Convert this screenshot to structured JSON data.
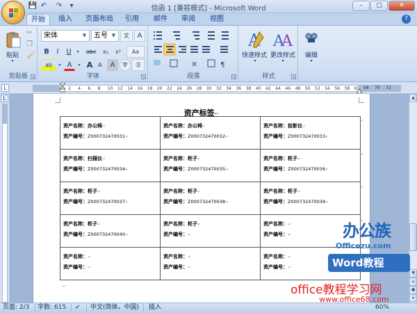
{
  "window": {
    "title": "信函 1 [兼容模式] - Microsoft Word",
    "buttons": {
      "minimize": "–",
      "maximize": "□",
      "close": "✕"
    }
  },
  "quick_access": {
    "save": "💾",
    "undo": "↶",
    "redo": "↷",
    "customize": "▾"
  },
  "tabs": [
    {
      "label": "开始",
      "active": true
    },
    {
      "label": "插入",
      "active": false
    },
    {
      "label": "页面布局",
      "active": false
    },
    {
      "label": "引用",
      "active": false
    },
    {
      "label": "邮件",
      "active": false
    },
    {
      "label": "审阅",
      "active": false
    },
    {
      "label": "视图",
      "active": false
    }
  ],
  "ribbon": {
    "clipboard": {
      "group_label": "剪贴板",
      "paste_label": "粘贴"
    },
    "font": {
      "group_label": "字体",
      "font_name": "宋体",
      "font_size": "五号",
      "bold": "B",
      "italic": "I",
      "underline": "U",
      "strike": "abc",
      "subscript": "x₂",
      "superscript": "x²",
      "clear": "Aa",
      "highlight": "ab",
      "font_color": "A",
      "grow": "A",
      "phonetic": "文",
      "enclose": "字",
      "shrink": "A",
      "char_border": "A",
      "char_shading": "A",
      "phonetic_guide": "㊄"
    },
    "paragraph": {
      "group_label": "段落"
    },
    "styles": {
      "group_label": "样式",
      "quick_styles": "快速样式",
      "change_styles": "更改样式"
    },
    "editing": {
      "label": "编辑"
    }
  },
  "ruler": {
    "left_ticks": [
      "6",
      "4",
      "2"
    ],
    "ticks": [
      "2",
      "4",
      "6",
      "8",
      "10",
      "12",
      "14",
      "16",
      "18",
      "20",
      "22",
      "24",
      "26",
      "28",
      "30",
      "32",
      "34",
      "36",
      "38",
      "40",
      "42",
      "44",
      "46",
      "48",
      "50",
      "52",
      "54",
      "56",
      "58",
      "60",
      "62",
      "64"
    ],
    "right_ticks": [
      "68",
      "70",
      "72"
    ]
  },
  "document": {
    "heading": "资产标签",
    "para_mark": "↵",
    "name_label": "资产名称：",
    "code_label": "资产编号：",
    "rows": [
      [
        {
          "name": "办公椅",
          "code": "Z000732470031"
        },
        {
          "name": "办公椅",
          "code": "Z000732470032"
        },
        {
          "name": "投影仪",
          "code": "Z000732470033"
        }
      ],
      [
        {
          "name": "扫描仪",
          "code": "Z000732470034"
        },
        {
          "name": "柜子",
          "code": "Z000732470035"
        },
        {
          "name": "柜子",
          "code": "Z000732470036"
        }
      ],
      [
        {
          "name": "柜子",
          "code": "Z000732470037"
        },
        {
          "name": "柜子",
          "code": "Z000732470038"
        },
        {
          "name": "柜子",
          "code": "Z000732470039"
        }
      ],
      [
        {
          "name": "柜子",
          "code": "Z000732470040"
        },
        {
          "name": "柜子",
          "code": ""
        },
        {
          "name": "",
          "code": ""
        }
      ],
      [
        {
          "name": "",
          "code": ""
        },
        {
          "name": "",
          "code": ""
        },
        {
          "name": "",
          "code": ""
        }
      ]
    ]
  },
  "watermark": {
    "brand": "办公族",
    "brand_url": "Officezu.com",
    "word_badge": "Word教程",
    "site": "office教程学习网",
    "site_url": "www.office68.com"
  },
  "status": {
    "page": "页面: 2/3",
    "words": "字数: 615",
    "language": "中文(简体，中国)",
    "mode": "插入",
    "zoom": "60%"
  },
  "colors": {
    "ribbon_bg": "#d6e3f4",
    "accent": "#15428b",
    "active_button": "#ffd26a"
  }
}
